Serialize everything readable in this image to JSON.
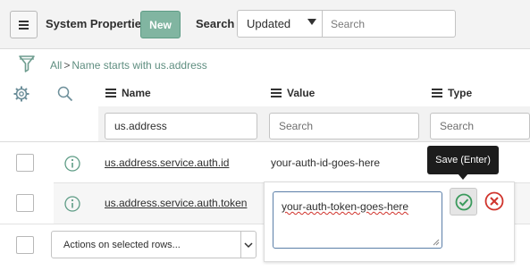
{
  "header": {
    "menu_icon": "hamburger-icon",
    "title": "System Properties",
    "new_label": "New",
    "search_label": "Search",
    "search_field_selected": "Updated",
    "search_placeholder": "Search"
  },
  "breadcrumb": {
    "filter_icon": "filter-icon",
    "all": "All",
    "separator": ">",
    "condition": "Name starts with us.address"
  },
  "columns": {
    "name": "Name",
    "value": "Value",
    "type": "Type"
  },
  "column_search": {
    "name_value": "us.address",
    "value_placeholder": "Search",
    "type_placeholder": "Search"
  },
  "rows": [
    {
      "name": "us.address.service.auth.id",
      "value": "your-auth-id-goes-here"
    },
    {
      "name": "us.address.service.auth.token",
      "value": ""
    }
  ],
  "editor": {
    "value": "your-auth-token-goes-here",
    "tooltip": "Save (Enter)"
  },
  "actions": {
    "label": "Actions on selected rows..."
  },
  "colors": {
    "new_button": "#81b5a1",
    "link": "#5f8e80",
    "save_check": "#3a9a5c",
    "cancel_x": "#d0342c",
    "tooltip_bg": "#1c1c1c"
  }
}
